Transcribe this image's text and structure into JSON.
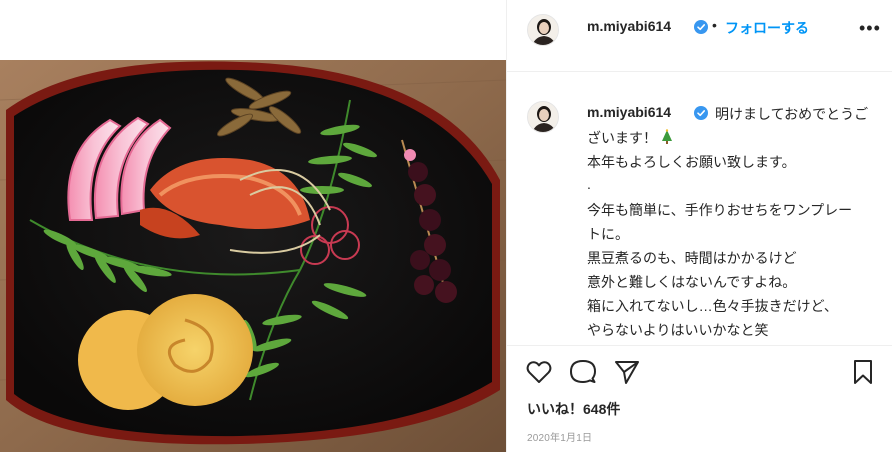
{
  "post": {
    "username": "m.miyabi614",
    "follow_separator": "•",
    "follow_label": "フォローする",
    "more_label": "•••",
    "caption_lines": [
      "明けましておめでとうご",
      "ざいます！",
      "本年もよろしくお願い致します。",
      ".",
      "今年も簡単に、手作りおせちをワンプレー",
      "トに。",
      "黒豆煮るのも、時間はかかるけど",
      "意外と難しくはないんですよね。",
      "箱に入れてないし…色々手抜きだけど、",
      "やらないよりはいいかなと笑",
      "."
    ],
    "likes": "いいね！648件",
    "date": "2020年1月1日"
  },
  "icons": {
    "verified": "verified-badge-icon",
    "like": "heart-icon",
    "comment": "comment-icon",
    "share": "share-icon",
    "save": "bookmark-icon",
    "caption_emoji": "christmas-tree-emoji"
  },
  "colors": {
    "link_blue": "#0095f6",
    "text": "#262626",
    "muted": "#9a9a9a",
    "border": "#efefef"
  }
}
